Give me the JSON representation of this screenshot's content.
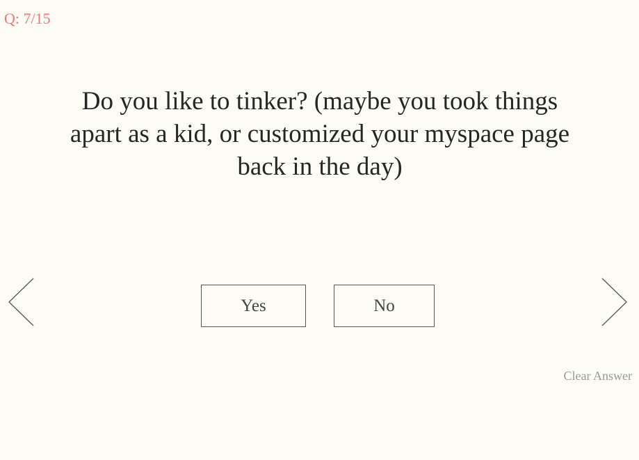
{
  "progress": {
    "label": "Q: 7/15",
    "current": 7,
    "total": 15
  },
  "question": {
    "text": "Do you like to tinker? (maybe you took things apart as a kid, or customized your myspace page back in the day)"
  },
  "answers": [
    {
      "label": "Yes"
    },
    {
      "label": "No"
    }
  ],
  "navigation": {
    "prev_icon": "chevron-left-icon",
    "next_icon": "chevron-right-icon"
  },
  "clear": {
    "label": "Clear Answer"
  },
  "colors": {
    "background": "#fcfcf5",
    "counter": "#f07575",
    "question_text": "#262626",
    "button_border": "#555555",
    "clear_text": "#999999"
  }
}
